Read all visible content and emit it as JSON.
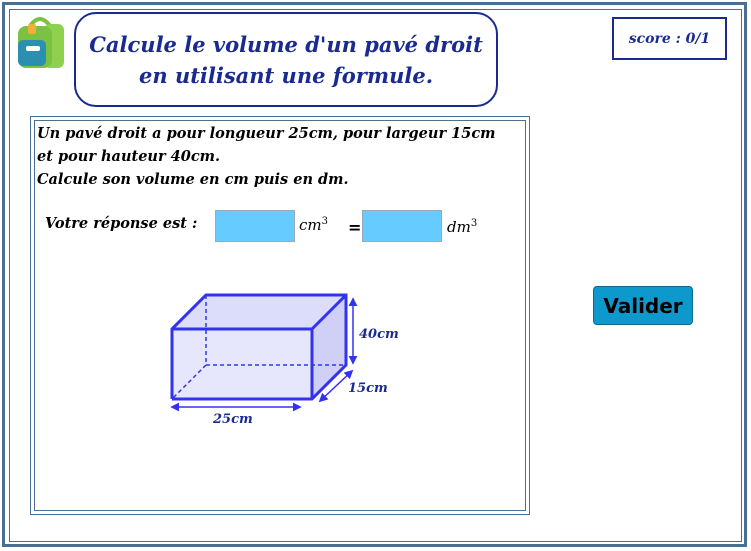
{
  "header": {
    "title_line1": "Calcule le volume d'un pavé droit",
    "title_line2": "en utilisant une formule.",
    "score": "score : 0/1",
    "bag_icon": "backpack-icon"
  },
  "problem": {
    "line1": "Un pavé droit a pour longueur 25cm, pour largeur 15cm",
    "line2": "et pour hauteur 40cm.",
    "line3": "Calcule son volume en cm puis en dm."
  },
  "answer": {
    "label": "Votre réponse est :",
    "cm_value": "",
    "dm_value": "",
    "unit_cm": "cm",
    "unit_dm": "dm",
    "exponent": "3",
    "equals": "="
  },
  "figure": {
    "height_label": "40cm",
    "width_label": "15cm",
    "length_label": "25cm"
  },
  "actions": {
    "validate_label": "Valider"
  },
  "colors": {
    "frame": "#4a6f92",
    "accent": "#1a2b8f",
    "input_fill": "#66ccff",
    "button_fill": "#0d99cc",
    "box_stroke": "#3333ee"
  }
}
